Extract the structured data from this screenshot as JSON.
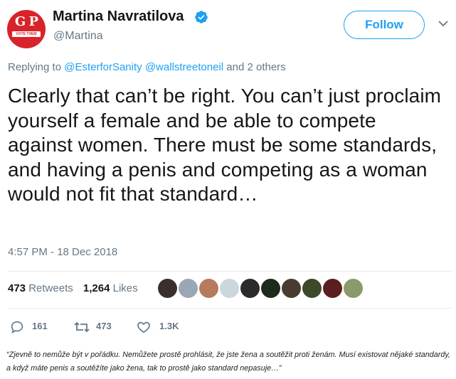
{
  "user": {
    "name": "Martina Navratilova",
    "handle": "@Martina",
    "avatar_text": "G P",
    "avatar_ribbon": "VOTE THEM OUT!"
  },
  "follow_label": "Follow",
  "replying": {
    "prefix": "Replying to ",
    "mention1": "@EsterforSanity",
    "mention2": "@wallstreetoneil",
    "suffix": " and 2 others"
  },
  "tweet_text": "Clearly that can’t be right. You can’t just proclaim yourself a female and be able to compete against women. There must be some standards, and having a penis and competing as a woman would not fit that standard…",
  "timestamp": "4:57 PM - 18 Dec 2018",
  "stats": {
    "retweets_count": "473",
    "retweets_label": "Retweets",
    "likes_count": "1,264",
    "likes_label": "Likes"
  },
  "likers": [
    {
      "name": "liker-1",
      "color": "#3a2f2c"
    },
    {
      "name": "liker-2",
      "color": "#9aa7b5"
    },
    {
      "name": "liker-3",
      "color": "#b77a5c"
    },
    {
      "name": "liker-4",
      "color": "#ccd6dd"
    },
    {
      "name": "liker-5",
      "color": "#2b2b2b"
    },
    {
      "name": "liker-6",
      "color": "#1f2a1f"
    },
    {
      "name": "liker-7",
      "color": "#4a3b30"
    },
    {
      "name": "liker-8",
      "color": "#3c4a2a"
    },
    {
      "name": "liker-9",
      "color": "#5b1f1f"
    },
    {
      "name": "liker-10",
      "color": "#8a9a6a"
    }
  ],
  "actions": {
    "replies": "161",
    "retweets": "473",
    "likes": "1.3K"
  },
  "caption": "“Zjevně to nemůže být v pořádku. Nemůžete prostě prohlásit, že jste žena a soutěžit proti ženám. Musí existovat nějaké standardy, a když máte penis a soutěžíte jako žena, tak to prostě jako standard nepasuje…”",
  "colors": {
    "accent": "#1da1f2",
    "muted": "#657786",
    "text": "#14171a"
  }
}
